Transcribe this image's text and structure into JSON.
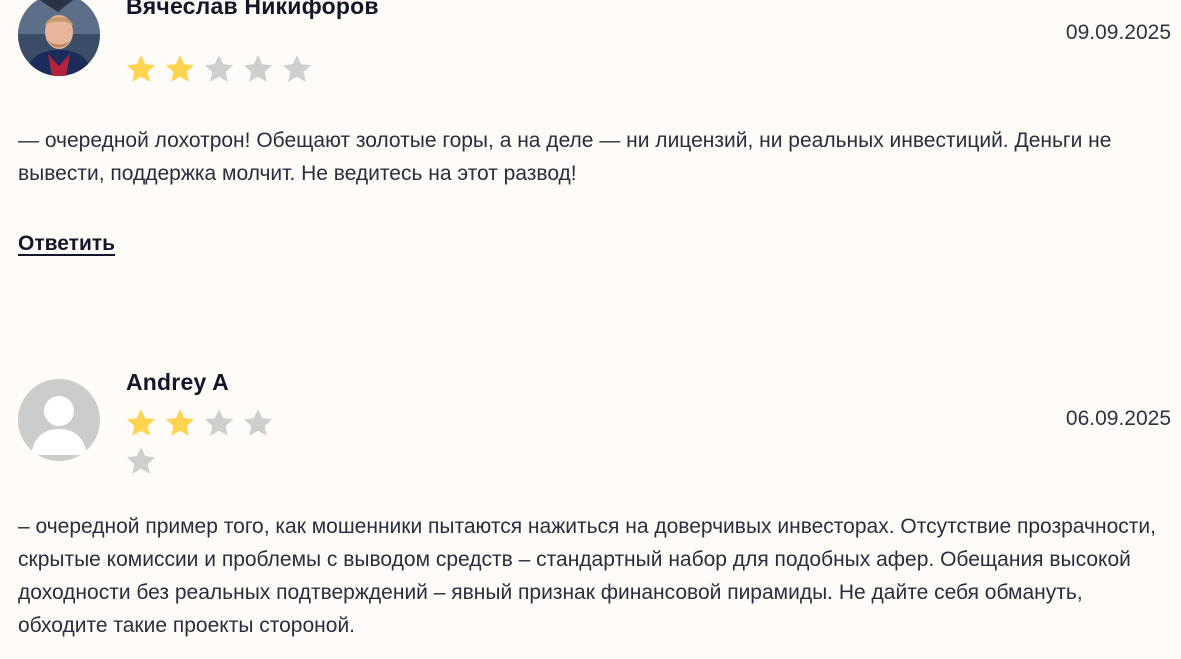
{
  "reviews": [
    {
      "author": "Вячеслав Никифоров",
      "date": "09.09.2025",
      "rating": 2,
      "max_rating": 5,
      "text": "— очередной лохотрон! Обещают золотые горы, а на деле — ни лицензий, ни реальных инвестиций. Деньги не вывести, поддержка молчит. Не ведитесь на этот развод!",
      "reply_label": "Ответить",
      "avatar": "user-photo"
    },
    {
      "author": "Andrey A",
      "date": "06.09.2025",
      "rating": 2,
      "max_rating": 5,
      "text": "– очередной пример того, как мошенники пытаются нажиться на доверчивых инвесторах. Отсутствие прозрачности, скрытые комиссии и проблемы с выводом средств – стандартный набор для подобных афер. Обещания высокой доходности без реальных подтверждений – явный признак финансовой пирамиды. Не дайте себя обмануть, обходите такие проекты стороной.",
      "avatar": "default-user-icon"
    }
  ],
  "colors": {
    "background": "#fffbf8",
    "star_filled": "#ffd451",
    "star_empty": "#cfcfcf",
    "text": "#2a2d3e",
    "heading": "#14172a"
  }
}
